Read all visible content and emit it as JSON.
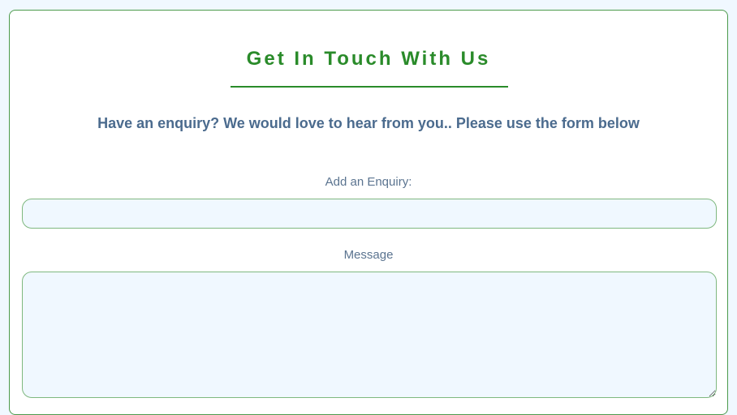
{
  "contact": {
    "title": "Get In Touch With Us",
    "subtitle": "Have an enquiry? We would love to hear from you.. Please use the form below",
    "enquiry_label": "Add an Enquiry:",
    "enquiry_value": "",
    "message_label": "Message",
    "message_value": ""
  },
  "colors": {
    "accent": "#2a8b2a",
    "text": "#4b6b8e",
    "field_background": "#f0f8ff",
    "field_border": "#7fb87f"
  }
}
